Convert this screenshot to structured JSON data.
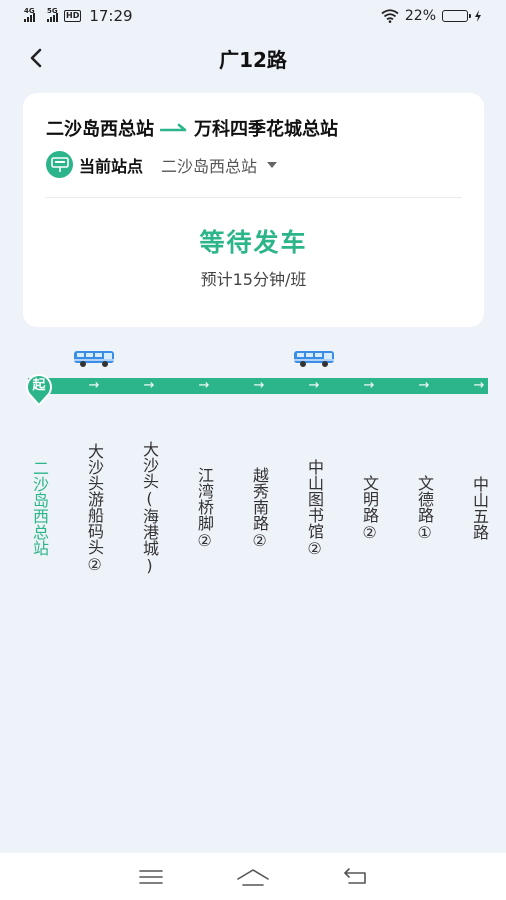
{
  "status_bar": {
    "signal1": "4G",
    "signal2": "5G",
    "hd": "HD",
    "time": "17:29",
    "battery_text": "22%",
    "battery_level": 0.22
  },
  "header": {
    "title": "广12路"
  },
  "route": {
    "from": "二沙岛西总站",
    "to": "万科四季花城总站"
  },
  "current_stop": {
    "label": "当前站点",
    "value": "二沙岛西总站"
  },
  "departure": {
    "status": "等待发车",
    "interval": "预计15分钟/班"
  },
  "line": {
    "start_label": "起",
    "stops": [
      "二沙岛西总站",
      "大沙头游船码头②",
      "大沙头(海港城)",
      "江湾桥脚②",
      "越秀南路②",
      "中山图书馆②",
      "文明路②",
      "文德路①",
      "中山五路"
    ],
    "current_index": 0,
    "bus_positions": [
      1,
      5
    ]
  },
  "colors": {
    "accent": "#2cb58a",
    "background": "#eef2f9",
    "bus_blue": "#3a8de6"
  }
}
